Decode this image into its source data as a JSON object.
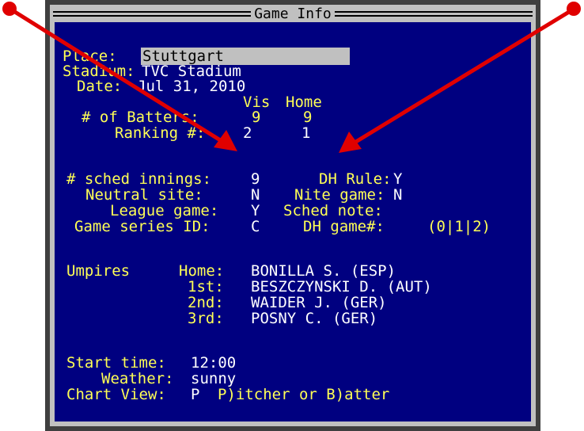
{
  "window": {
    "title": "Game Info"
  },
  "place": {
    "label": "Place:",
    "value": "Stuttgart"
  },
  "stadium": {
    "label": "Stadium:",
    "value": "TVC Stadium"
  },
  "date": {
    "label": "Date:",
    "value": "Jul 31, 2010"
  },
  "teams": {
    "vis_header": "Vis",
    "home_header": "Home"
  },
  "batters": {
    "label": "# of Batters:",
    "vis": "9",
    "home": "9"
  },
  "ranking": {
    "label": "Ranking #:",
    "vis": "2",
    "home": "1"
  },
  "settings": {
    "sched_innings_label": "# sched innings:",
    "sched_innings": "9",
    "dh_rule_label": "DH Rule:",
    "dh_rule": "Y",
    "neutral_label": "Neutral site:",
    "neutral": "N",
    "nite_label": "Nite game:",
    "nite": "N",
    "league_label": "League game:",
    "league": "Y",
    "sched_note_label": "Sched note:",
    "series_label": "Game series ID:",
    "series": "C",
    "dh_game_label": "DH game#:",
    "dh_game": "(0|1|2)"
  },
  "umpires": {
    "label": "Umpires",
    "home_label": "Home:",
    "home": "BONILLA S. (ESP)",
    "first_label": "1st:",
    "first": "BESZCZYNSKI D. (AUT)",
    "second_label": "2nd:",
    "second": "WAIDER J. (GER)",
    "third_label": "3rd:",
    "third": "POSNY C. (GER)"
  },
  "start_time": {
    "label": "Start time:",
    "value": "12:00"
  },
  "weather": {
    "label": "Weather:",
    "value": "sunny"
  },
  "chart_view": {
    "label": "Chart View:",
    "value": "P",
    "hint": "P)itcher or B)atter"
  },
  "colors": {
    "background": "#000080",
    "label": "#ffff55",
    "value": "#ffffff",
    "annotation": "#e00000"
  }
}
